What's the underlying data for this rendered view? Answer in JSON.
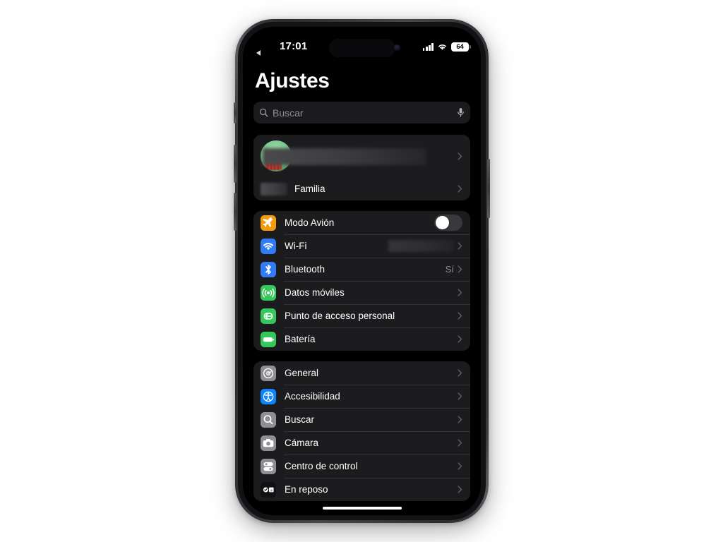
{
  "device": {
    "model_hint": "iphone-pro",
    "frame_color": "#46464b",
    "screen_bg": "#000000"
  },
  "status_bar": {
    "back_affordance": "◀",
    "time": "17:01",
    "cellular_icon": "signal-bars-icon",
    "wifi_icon": "wifi-icon",
    "battery_level": "64",
    "battery_icon": "battery-icon"
  },
  "header": {
    "title": "Ajustes"
  },
  "search": {
    "placeholder": "Buscar",
    "value": "",
    "search_icon": "search-icon",
    "mic_icon": "microphone-icon"
  },
  "account_group": {
    "profile": {
      "name_redacted": true,
      "name": "",
      "avatar_icon": "user-avatar",
      "chevron": "chevron-right-icon"
    },
    "family": {
      "label": "Familia",
      "icon_redacted": true,
      "chevron": "chevron-right-icon"
    }
  },
  "connectivity_group": {
    "items": [
      {
        "label": "Modo Avión",
        "icon": "airplane-icon",
        "icon_color": "#f59b0b",
        "accessory": "toggle",
        "toggle_on": false,
        "value": ""
      },
      {
        "label": "Wi-Fi",
        "icon": "wifi-icon",
        "icon_color": "#2f7cf6",
        "accessory": "chevron",
        "value_redacted": true,
        "value": ""
      },
      {
        "label": "Bluetooth",
        "icon": "bluetooth-icon",
        "icon_color": "#2f7cf6",
        "accessory": "chevron",
        "value": "Sí"
      },
      {
        "label": "Datos móviles",
        "icon": "cellular-antenna-icon",
        "icon_color": "#34c759",
        "accessory": "chevron",
        "value": ""
      },
      {
        "label": "Punto de acceso personal",
        "icon": "hotspot-link-icon",
        "icon_color": "#34c759",
        "accessory": "chevron",
        "value": ""
      },
      {
        "label": "Batería",
        "icon": "battery-icon",
        "icon_color": "#34c759",
        "accessory": "chevron",
        "value": ""
      }
    ]
  },
  "system_group": {
    "items": [
      {
        "label": "General",
        "icon": "gear-icon",
        "icon_color": "#8e8e93",
        "accessory": "chevron"
      },
      {
        "label": "Accesibilidad",
        "icon": "accessibility-icon",
        "icon_color": "#0a84ff",
        "accessory": "chevron"
      },
      {
        "label": "Buscar",
        "icon": "search-icon",
        "icon_color": "#8e8e93",
        "accessory": "chevron"
      },
      {
        "label": "Cámara",
        "icon": "camera-icon",
        "icon_color": "#8e8e93",
        "accessory": "chevron"
      },
      {
        "label": "Centro de control",
        "icon": "control-center-icon",
        "icon_color": "#8e8e93",
        "accessory": "chevron"
      },
      {
        "label": "En reposo",
        "icon": "standby-icon",
        "icon_color": "#111114",
        "accessory": "chevron"
      }
    ]
  },
  "colors": {
    "page_bg": "#000000",
    "group_bg": "#1c1c1e",
    "separator": "#323234",
    "primary_text": "#ffffff",
    "secondary_text": "#8e8e93",
    "search_bg": "#1b1b1d"
  }
}
